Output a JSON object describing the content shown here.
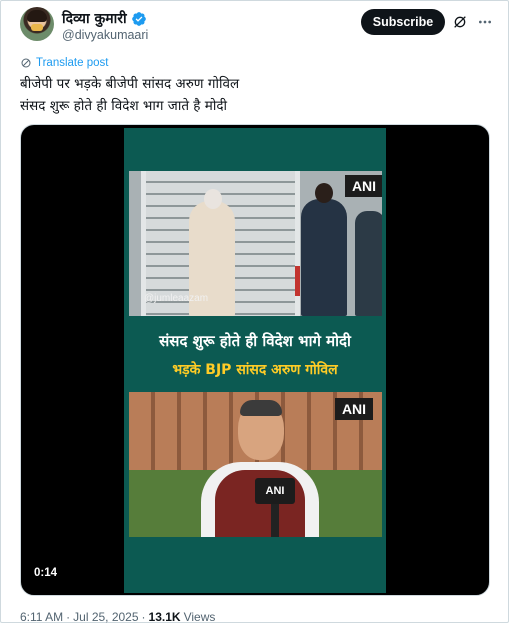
{
  "author": {
    "display_name": "दिव्या कुमारी",
    "handle": "@divyakumaari",
    "verified_color": "#1d9bf0"
  },
  "actions": {
    "subscribe_label": "Subscribe",
    "grok_icon": "grok-icon",
    "more_icon": "more-icon"
  },
  "tweet": {
    "translate_label": "Translate post",
    "lines": [
      "बीजेपी पर भड़के बीजेपी सांसद अरुण गोविल",
      "संसद शुरू होते ही विदेश भाग जाते है मोदी"
    ]
  },
  "media": {
    "video_duration": "0:14",
    "watermark": "@jumleaazam",
    "top_badge": "ANI",
    "bottom_badge": "ANI",
    "mic_label": "ANI",
    "headline_white": "संसद शुरू होते ही विदेश भागे मोदी",
    "headline_yellow": "भड़के BJP सांसद अरुण गोविल"
  },
  "meta": {
    "time": "6:11 AM",
    "separator": "·",
    "date": "Jul 25, 2025",
    "separator2": "·",
    "views_count": "13.1K",
    "views_label": "Views"
  }
}
